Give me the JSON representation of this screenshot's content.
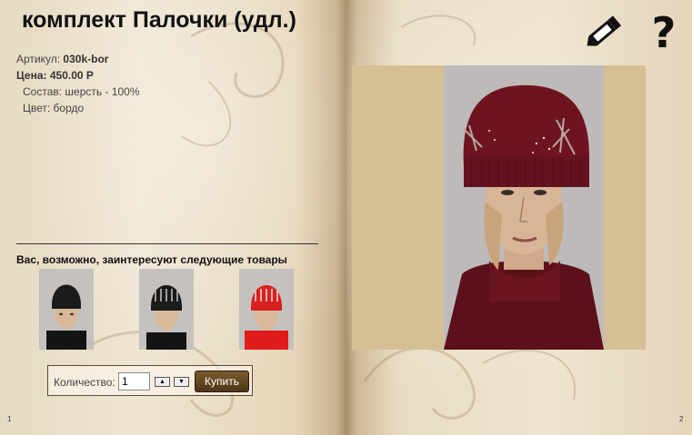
{
  "product": {
    "title": "комплект Палочки (удл.)",
    "article_label": "Артикул:",
    "article_value": "030k-bor",
    "price_label": "Цена:",
    "price_value": "450.00 Р",
    "composition": "Состав: шерсть - 100%",
    "color": "Цвет: бордо"
  },
  "related": {
    "title": "Вас, возможно, заинтересуют следующие товары",
    "items": [
      {
        "name": "black-hat-plain",
        "color": "#1a1a1a"
      },
      {
        "name": "black-hat-sticks",
        "color": "#1a1a1a"
      },
      {
        "name": "red-hat-sticks",
        "color": "#d8201e"
      }
    ]
  },
  "order": {
    "qty_label": "Количество:",
    "qty_value": "1",
    "buy_label": "Купить"
  },
  "pages": {
    "left": "1",
    "right": "2"
  },
  "icons": {
    "edit": "pencil-icon",
    "help": "question-icon"
  },
  "colors": {
    "hat_main": "#6e1420",
    "button_brown": "#5b3f1c"
  }
}
